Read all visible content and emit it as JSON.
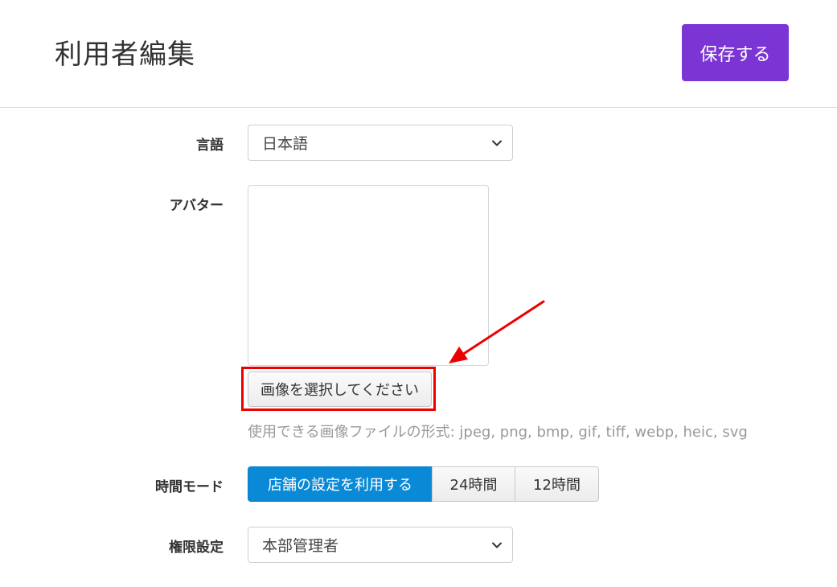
{
  "header": {
    "title": "利用者編集",
    "save_label": "保存する"
  },
  "form": {
    "language": {
      "label": "言語",
      "value": "日本語"
    },
    "avatar": {
      "label": "アバター",
      "button_label": "画像を選択してください",
      "hint": "使用できる画像ファイルの形式: jpeg, png, bmp, gif, tiff, webp, heic, svg"
    },
    "time_mode": {
      "label": "時間モード",
      "options": [
        "店舗の設定を利用する",
        "24時間",
        "12時間"
      ],
      "selected": "店舗の設定を利用する"
    },
    "permission": {
      "label": "権限設定",
      "value": "本部管理者"
    }
  },
  "colors": {
    "accent": "#7b35d4",
    "active_toggle": "#0a8ad6",
    "annotation": "#ee0000"
  },
  "icons": {
    "select_chevron": "chevron-down-icon",
    "annotation_arrow": "arrow-icon"
  }
}
